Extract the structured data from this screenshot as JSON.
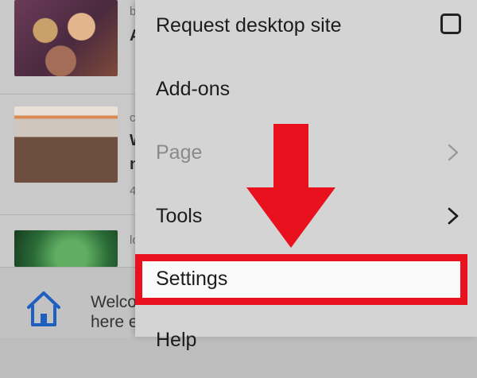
{
  "feed": {
    "items": [
      {
        "meta": "b",
        "headline": "A"
      },
      {
        "meta": "c",
        "headline_line1": "W",
        "headline_line2": "n",
        "extra": "4"
      },
      {
        "meta": "lo"
      }
    ]
  },
  "bottom_bar": {
    "welcome_line1": "Welco",
    "welcome_line2": "here e"
  },
  "menu": {
    "request_desktop_site": "Request desktop site",
    "add_ons": "Add-ons",
    "page": "Page",
    "tools": "Tools",
    "settings": "Settings",
    "help_partial": "Help"
  },
  "colors": {
    "highlight": "#e8111d",
    "arrow": "#e8111d"
  }
}
